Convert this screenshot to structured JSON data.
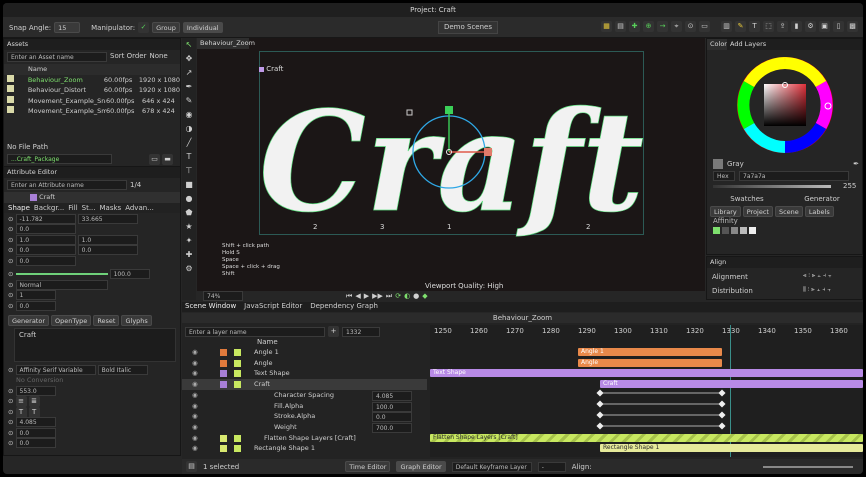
{
  "window": {
    "title": "Project: Craft"
  },
  "toolbar": {
    "snap_angle_label": "Snap Angle:",
    "snap_angle_value": "15",
    "manipulator_label": "Manipulator:",
    "group_label": "Group",
    "individual_label": "Individual",
    "demo_scenes_label": "Demo Scenes"
  },
  "assets": {
    "tab": "Assets",
    "search_placeholder": "Enter an Asset name",
    "sort_order_label": "Sort Order",
    "sort_order_value": "None",
    "name_header": "Name",
    "items": [
      {
        "name": "Behaviour_Zoom",
        "fps": "60.00fps",
        "res": "1920 x 1080",
        "active": true
      },
      {
        "name": "Behaviour_Distort",
        "fps": "60.00fps",
        "res": "1920 x 1080",
        "active": false
      },
      {
        "name": "Movement_Example_Snap",
        "fps": "60.00fps",
        "res": "646 x 424",
        "active": false
      },
      {
        "name": "Movement_Example_Smooth",
        "fps": "60.00fps",
        "res": "678 x 424",
        "active": false
      }
    ],
    "no_file_path": "No File Path",
    "package": "...Craft_Package"
  },
  "attr": {
    "tab": "Attribute Editor",
    "search_placeholder": "Enter an Attribute name",
    "page": "1/4",
    "layer_name": "Craft",
    "tabs": [
      "Shape",
      "Backgr...",
      "Fill",
      "St...",
      "Masks",
      "Advan..."
    ],
    "pos_x": "-11.782",
    "pos_y": "33.665",
    "z": "0.0",
    "scale_x": "1.0",
    "scale_y": "1.0",
    "rot_x": "0.0",
    "rot_y": "0.0",
    "opacity": "100.0",
    "blend": "Normal",
    "val1": "1",
    "val2": "0.0",
    "generator": "Generator",
    "opentype": "OpenType",
    "reset": "Reset",
    "glyphs": "Glyphs",
    "text": "Craft",
    "font": "Affinity Serif Variable",
    "weight": "Bold Italic",
    "no_font_note": "No Conversion",
    "size": "553.0",
    "spacing": "4.085",
    "v_a": "0.0",
    "v_b": "0.0"
  },
  "viewport": {
    "tab": "Behaviour_Zoom",
    "layer_label": "Craft",
    "glyph_text": "Craft",
    "index_labels": [
      "2",
      "3",
      "1",
      "2"
    ],
    "hints": [
      "Shift + click path",
      "Hold S",
      "Space",
      "Space + click + drag",
      "Shift"
    ],
    "quality": "Viewport Quality: High",
    "zoom": "74%"
  },
  "color": {
    "tabs": [
      "Color",
      "Add Layers"
    ],
    "swatch_name": "Gray",
    "mode": "Hex",
    "hex": "7a7a7a",
    "alpha": "255",
    "swatches_label": "Swatches",
    "generator_label": "Generator",
    "lib_tabs": [
      "Library",
      "Project",
      "Scene",
      "Labels"
    ],
    "affinity": "Affinity",
    "accent": "#7ee06e"
  },
  "align": {
    "tab": "Align",
    "alignment": "Alignment",
    "distribution": "Distribution"
  },
  "bottom_tabs": [
    "Scene Window",
    "JavaScript Editor",
    "Dependency Graph"
  ],
  "scene": {
    "title": "Behaviour_Zoom",
    "search_placeholder": "Enter a layer name",
    "frame": "1332",
    "name_header": "Name",
    "layers": [
      {
        "name": "Angle 1",
        "color": "#e07a3c",
        "indent": 1
      },
      {
        "name": "Angle",
        "color": "#e07a3c",
        "indent": 1
      },
      {
        "name": "Text Shape",
        "color": "#a77fd6",
        "indent": 1
      },
      {
        "name": "Craft",
        "color": "#a77fd6",
        "indent": 1
      },
      {
        "name": "Character Spacing",
        "value": "4.085",
        "indent": 3
      },
      {
        "name": "Fill.Alpha",
        "value": "100.0",
        "indent": 3
      },
      {
        "name": "Stroke.Alpha",
        "value": "0.0",
        "indent": 3
      },
      {
        "name": "Weight",
        "value": "700.0",
        "indent": 3
      },
      {
        "name": "Flatten Shape Layers [Craft]",
        "color": "#d8e870",
        "indent": 2
      },
      {
        "name": "Rectangle Shape 1",
        "color": "#d8e870",
        "indent": 1
      }
    ],
    "ruler": [
      "1250",
      "1260",
      "1270",
      "1280",
      "1290",
      "1300",
      "1310",
      "1320",
      "1330",
      "1340",
      "1350",
      "1360"
    ],
    "bars": [
      {
        "label": "Angle 1",
        "color": "#e8894a"
      },
      {
        "label": "Angle",
        "color": "#e8894a"
      },
      {
        "label": "Text Shape",
        "color": "#b88ae6"
      },
      {
        "label": "Craft",
        "color": "#b88ae6"
      },
      {
        "label": "Flatten Shape Layers [Craft]",
        "color": "#c8e860"
      },
      {
        "label": "Rectangle Shape 1",
        "color": "#e6ea9a"
      }
    ],
    "selected": "1 selected",
    "time_editor": "Time Editor",
    "graph_editor": "Graph Editor",
    "keyframe_layer": "Default Keyframe Layer",
    "align": "Align:"
  }
}
